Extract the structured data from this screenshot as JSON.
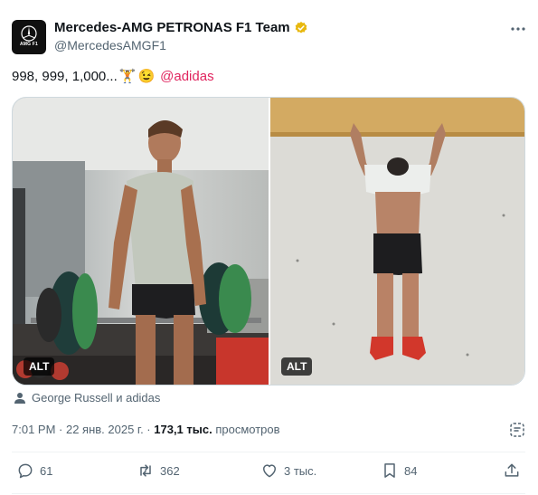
{
  "author": {
    "display_name": "Mercedes-AMG PETRONAS F1 Team",
    "handle": "@MercedesAMGF1",
    "avatar_text": "AMG F1"
  },
  "tweet": {
    "text": "998, 999, 1,000...",
    "emoji_1": "🏋",
    "emoji_2": "😉",
    "mention": "@adidas"
  },
  "media": {
    "alt_left": "ALT",
    "alt_right": "ALT"
  },
  "tagged": "George Russell и adidas",
  "meta": {
    "timestamp": "7:01 PM · 22 янв. 2025 г. · ",
    "views_count": "173,1 тыс.",
    "views_label": " просмотров"
  },
  "actions": {
    "replies": "61",
    "reposts": "362",
    "likes": "3 тыс.",
    "bookmarks": "84"
  },
  "colors": {
    "accent_mention": "#e0245e",
    "verified_badge": "#e8b80e",
    "secondary_text": "#536471"
  }
}
